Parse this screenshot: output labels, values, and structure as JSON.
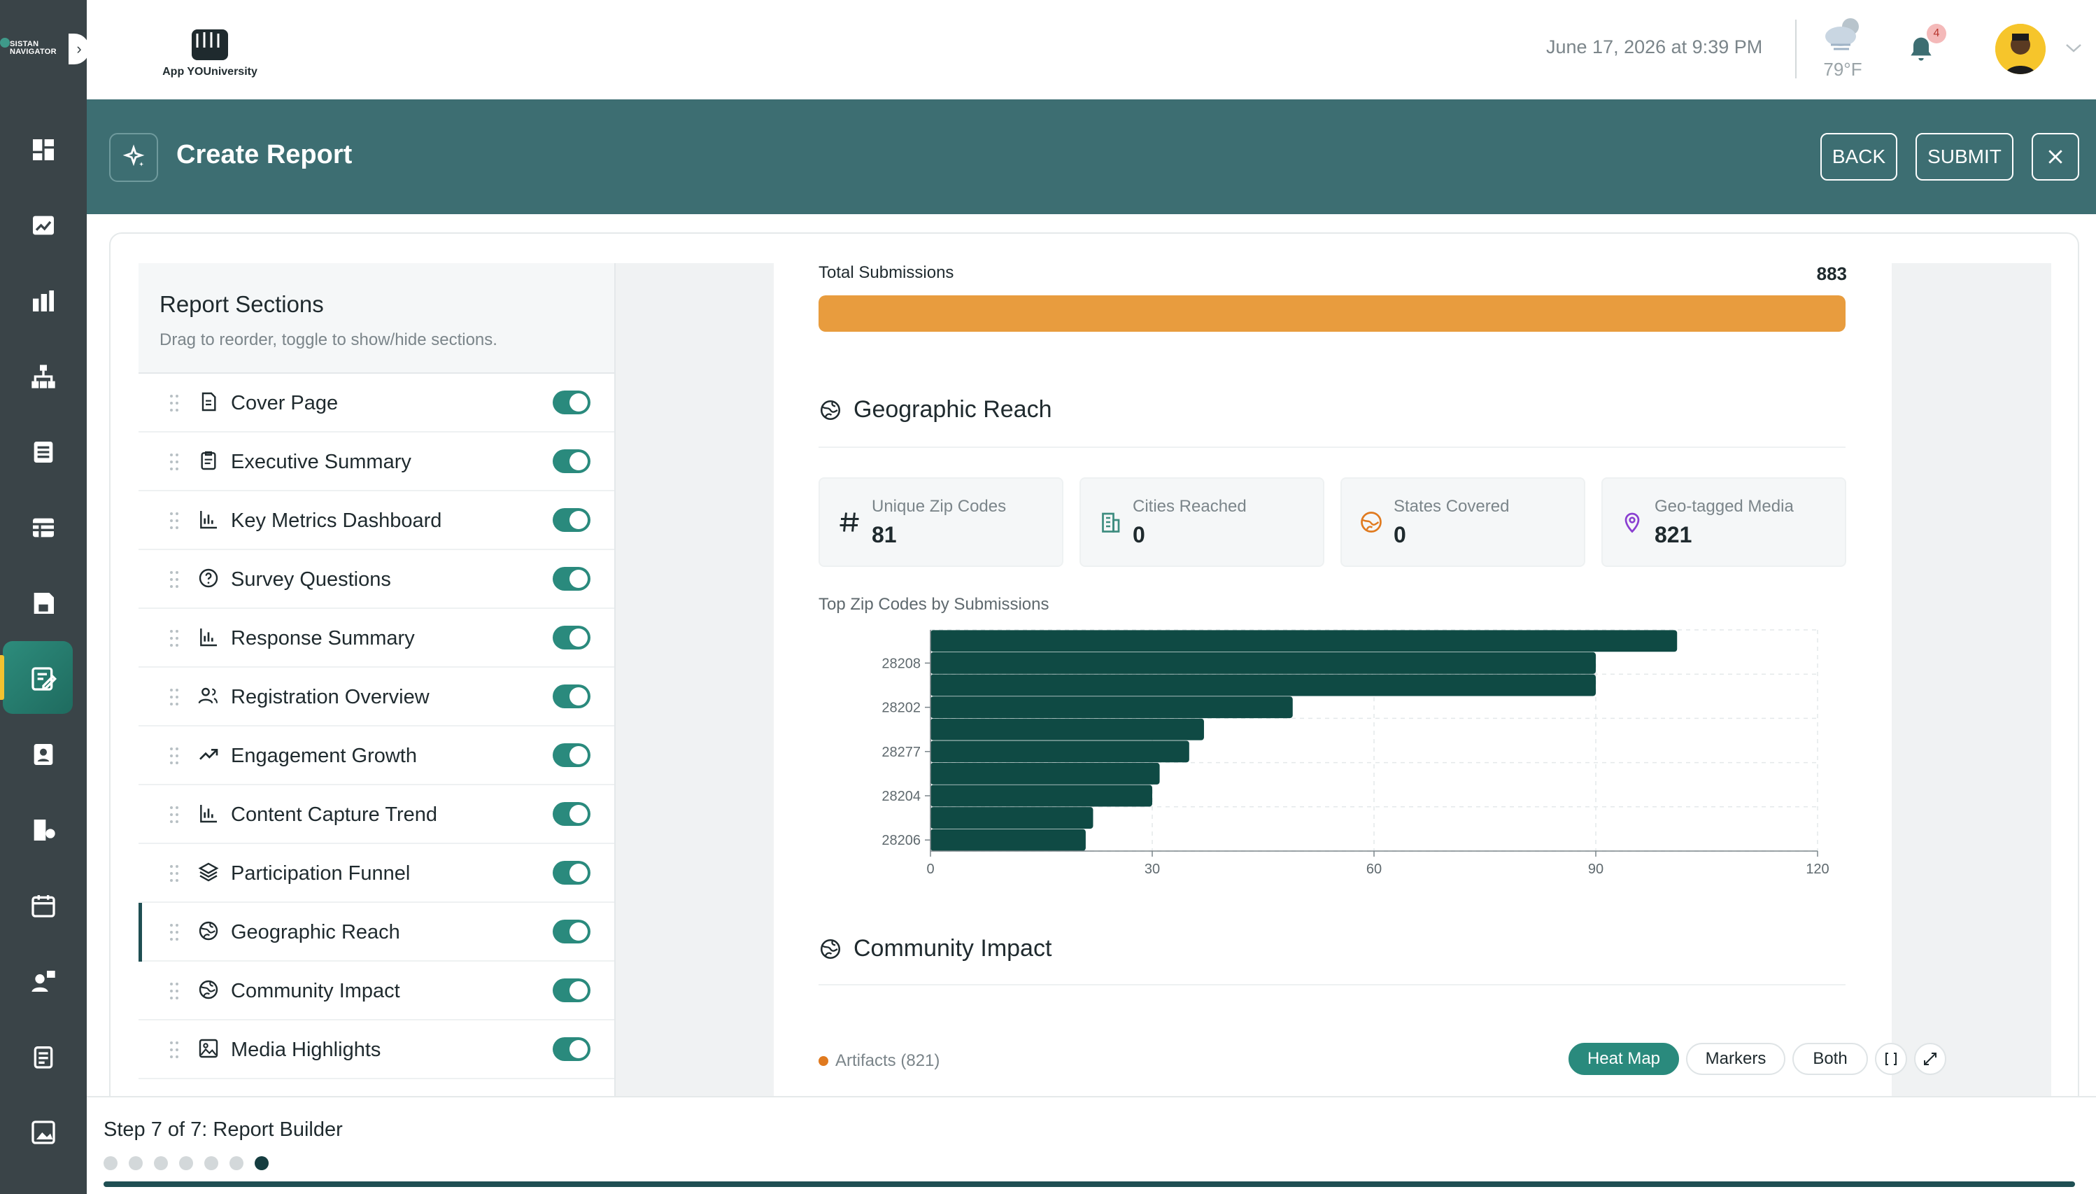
{
  "brand": {
    "name_line1": "SISTAN",
    "name_line2": "NAVIGATOR"
  },
  "app": {
    "logo_text": "App YOUniversity"
  },
  "header": {
    "datetime": "June 17, 2026 at 9:39 PM",
    "temperature": "79°F",
    "notification_count": "4"
  },
  "titlebar": {
    "title": "Create Report",
    "back_label": "BACK",
    "submit_label": "SUBMIT"
  },
  "sections_panel": {
    "title": "Report Sections",
    "subtitle": "Drag to reorder, toggle to show/hide sections.",
    "items": [
      {
        "label": "Cover Page",
        "icon": "document-icon",
        "enabled": true
      },
      {
        "label": "Executive Summary",
        "icon": "clipboard-icon",
        "enabled": true
      },
      {
        "label": "Key Metrics Dashboard",
        "icon": "bar-chart-icon",
        "enabled": true
      },
      {
        "label": "Survey Questions",
        "icon": "question-circle-icon",
        "enabled": true
      },
      {
        "label": "Response Summary",
        "icon": "bar-chart-icon",
        "enabled": true
      },
      {
        "label": "Registration Overview",
        "icon": "users-icon",
        "enabled": true
      },
      {
        "label": "Engagement Growth",
        "icon": "trend-up-icon",
        "enabled": true
      },
      {
        "label": "Content Capture Trend",
        "icon": "bar-chart-icon",
        "enabled": true
      },
      {
        "label": "Participation Funnel",
        "icon": "layers-icon",
        "enabled": true
      },
      {
        "label": "Geographic Reach",
        "icon": "globe-icon",
        "enabled": true,
        "active": true
      },
      {
        "label": "Community Impact",
        "icon": "globe-icon",
        "enabled": true
      },
      {
        "label": "Media Highlights",
        "icon": "image-icon",
        "enabled": true
      }
    ]
  },
  "preview": {
    "total_submissions": {
      "label": "Total Submissions",
      "value": "883",
      "fill_fraction": 1.0
    },
    "geographic_reach": {
      "title": "Geographic Reach",
      "stats": [
        {
          "label": "Unique Zip Codes",
          "value": "81",
          "icon": "hash-icon"
        },
        {
          "label": "Cities Reached",
          "value": "0",
          "icon": "building-icon"
        },
        {
          "label": "States Covered",
          "value": "0",
          "icon": "globe-orange-icon"
        },
        {
          "label": "Geo-tagged Media",
          "value": "821",
          "icon": "map-pin-icon"
        }
      ],
      "chart_title": "Top Zip Codes by Submissions"
    },
    "community_impact": {
      "title": "Community Impact",
      "artifacts_label": "Artifacts (821)",
      "view_modes": [
        "Heat Map",
        "Markers",
        "Both"
      ],
      "active_mode": "Heat Map"
    }
  },
  "chart_data": {
    "type": "bar",
    "orientation": "horizontal",
    "title": "Top Zip Codes by Submissions",
    "categories": [
      "",
      "28208",
      "",
      "28202",
      "",
      "28277",
      "",
      "28204",
      "",
      "28206"
    ],
    "values": [
      101,
      90,
      90,
      49,
      37,
      35,
      31,
      30,
      22,
      21
    ],
    "xlim": [
      0,
      120
    ],
    "xticks": [
      0,
      30,
      60,
      90,
      120
    ],
    "grid": true,
    "color": "#0f4a44"
  },
  "footer": {
    "step_label": "Step 7 of 7: Report Builder",
    "total_steps": 7,
    "current_step": 7,
    "progress_fraction": 1.0
  },
  "colors": {
    "sidebar": "#3a4448",
    "titlebar": "#3d6e72",
    "accent": "#2a8a7d",
    "bar_orange": "#e89c3e",
    "chart_bar": "#0f4a44"
  }
}
